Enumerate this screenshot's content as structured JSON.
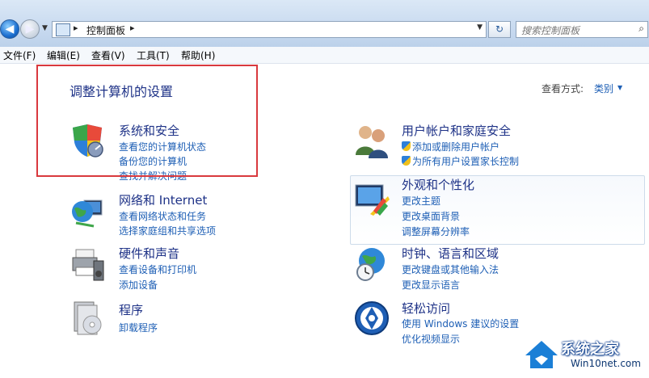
{
  "address_bar": {
    "breadcrumb": "控制面板",
    "search_placeholder": "搜索控制面板"
  },
  "menu": [
    "文件(F)",
    "编辑(E)",
    "查看(V)",
    "工具(T)",
    "帮助(H)"
  ],
  "heading": "调整计算机的设置",
  "view_by": {
    "label": "查看方式:",
    "value": "类别"
  },
  "categories_left": [
    {
      "title": "系统和安全",
      "links": [
        "查看您的计算机状态",
        "备份您的计算机",
        "查找并解决问题"
      ]
    },
    {
      "title": "网络和 Internet",
      "links": [
        "查看网络状态和任务",
        "选择家庭组和共享选项"
      ]
    },
    {
      "title": "硬件和声音",
      "links": [
        "查看设备和打印机",
        "添加设备"
      ]
    },
    {
      "title": "程序",
      "links": [
        "卸载程序"
      ]
    }
  ],
  "categories_right": [
    {
      "title": "用户帐户和家庭安全",
      "links": [
        "添加或删除用户帐户",
        "为所有用户设置家长控制"
      ]
    },
    {
      "title": "外观和个性化",
      "links": [
        "更改主题",
        "更改桌面背景",
        "调整屏幕分辨率"
      ]
    },
    {
      "title": "时钟、语言和区域",
      "links": [
        "更改键盘或其他输入法",
        "更改显示语言"
      ]
    },
    {
      "title": "轻松访问",
      "links": [
        "使用 Windows 建议的设置",
        "优化视频显示"
      ]
    }
  ],
  "watermark": {
    "brand": "系统之家",
    "site": "Win10net.com"
  },
  "colors": {
    "link": "#1e5fb5",
    "heading": "#1e3287",
    "highlight_box": "#d9393e"
  }
}
